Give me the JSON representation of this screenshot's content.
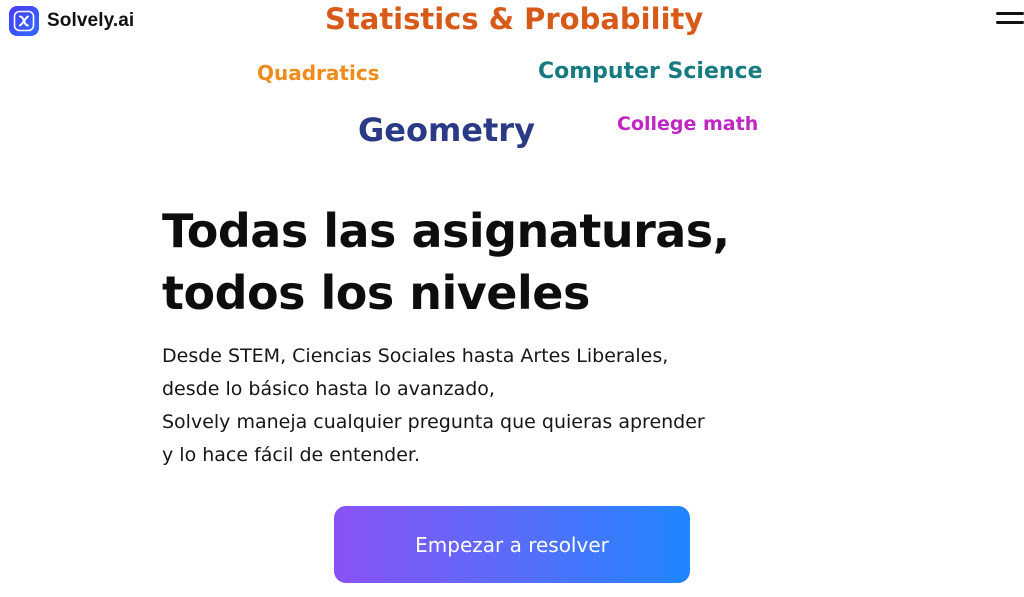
{
  "header": {
    "logo_text": "Solvely.ai",
    "logo_icon": "x-math-icon",
    "menu_icon": "hamburger-menu-icon"
  },
  "subjects": [
    {
      "label": "Statistics & Probability",
      "color": "#d85a1a"
    },
    {
      "label": "Quadratics",
      "color": "#f08c1c"
    },
    {
      "label": "Computer Science",
      "color": "#177a80"
    },
    {
      "label": "Geometry",
      "color": "#2a3a84"
    },
    {
      "label": "College math",
      "color": "#c026c4"
    }
  ],
  "hero": {
    "title_line1": "Todas las asignaturas,",
    "title_line2": "todos los niveles",
    "description": [
      "Desde STEM, Ciencias Sociales hasta Artes Liberales,",
      "desde lo básico hasta lo avanzado,",
      "Solvely maneja cualquier pregunta que quieras aprender",
      "y lo hace fácil de entender."
    ]
  },
  "cta": {
    "label": "Empezar a resolver",
    "gradient_start": "#8a52f5",
    "gradient_end": "#1f86ff"
  }
}
